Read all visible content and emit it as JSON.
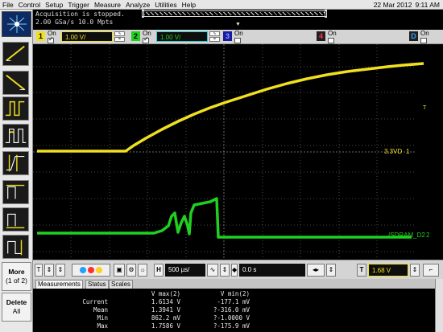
{
  "menu": {
    "items": [
      "File",
      "Control",
      "Setup",
      "Trigger",
      "Measure",
      "Analyze",
      "Utilities",
      "Help"
    ],
    "date": "22 Mar 2012",
    "time": "9:11 AM"
  },
  "status": {
    "line1": "Acquisition is stopped.",
    "line2": "2.00 GSa/s   10.0 Mpts"
  },
  "channels": [
    {
      "num": "1",
      "on_label": "On",
      "scale": "1.00 V/",
      "color": "#f0e020"
    },
    {
      "num": "2",
      "on_label": "On",
      "scale": "1.00 V/",
      "color": "#20d020"
    },
    {
      "num": "3",
      "on_label": "On",
      "color": "#3a5cff"
    },
    {
      "num": "4",
      "on_label": "On",
      "color": "#ff3050"
    },
    {
      "num": "D",
      "on_label": "On",
      "color": "#3090ff"
    }
  ],
  "plot": {
    "labels": {
      "ch1": "3.3VD",
      "ch2": "/SDRAM_D2"
    },
    "markers": {
      "ch1": "1",
      "ch2": "2",
      "trigger": "T"
    }
  },
  "sidebar": {
    "more_label": "More",
    "more_sub": "(1 of 2)",
    "delete_label": "Delete",
    "delete_sub": "All"
  },
  "controls": {
    "trig_tag": "T",
    "h_tag": "H",
    "timebase": "500 µs/",
    "delay": "0.0 s",
    "trig_level_tag": "T",
    "trig_level": "1.68 V"
  },
  "tabs": [
    "Measurements",
    "Status",
    "Scales"
  ],
  "measurements": {
    "headers": [
      "",
      "V max(2)",
      "V min(2)"
    ],
    "rows": [
      [
        "Current",
        "1.6134 V",
        "-177.1 mV"
      ],
      [
        "Mean",
        "1.3941 V",
        "?-316.0 mV"
      ],
      [
        "Min",
        "862.2 mV",
        "?-1.0000 V"
      ],
      [
        "Max",
        "1.7586 V",
        "?-175.9 mV"
      ]
    ]
  }
}
